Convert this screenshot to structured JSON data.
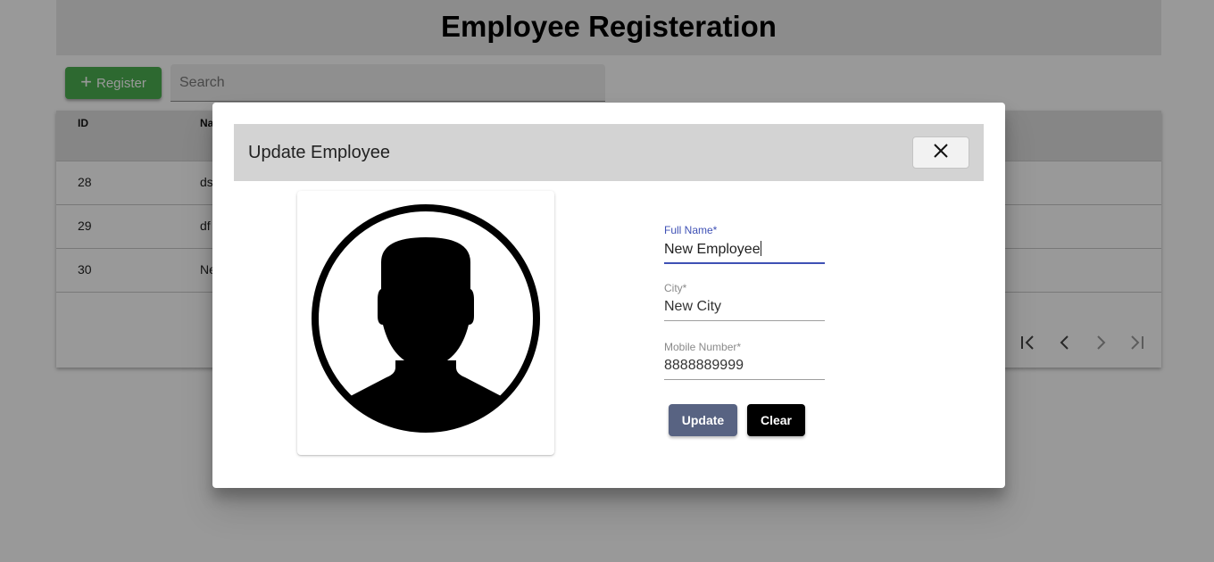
{
  "page": {
    "title": "Employee Registeration",
    "register_label": "Register",
    "search_placeholder": "Search"
  },
  "table": {
    "columns": [
      "ID",
      "Na"
    ],
    "rows": [
      {
        "id": "28",
        "name": "ds"
      },
      {
        "id": "29",
        "name": "df"
      },
      {
        "id": "30",
        "name": "Ne"
      }
    ],
    "pager": {
      "first": "|<",
      "prev": "<",
      "next": ">",
      "last": ">|"
    }
  },
  "dialog": {
    "title": "Update Employee",
    "close_symbol": "✕",
    "fields": {
      "full_name": {
        "label": "Full Name*",
        "value": "New Employee"
      },
      "city": {
        "label": "City*",
        "value": "New City"
      },
      "mobile": {
        "label": "Mobile Number*",
        "value": "8888889999"
      }
    },
    "update_label": "Update",
    "clear_label": "Clear"
  },
  "colors": {
    "register": "#4caf50",
    "focus": "#3f51b5",
    "update_button": "#4a5678",
    "clear_button": "#000000"
  },
  "icons": {
    "register": "plus-icon",
    "avatar": "user-silhouette-icon",
    "close": "close-icon",
    "pager": [
      "first-page-icon",
      "previous-page-icon",
      "next-page-icon",
      "last-page-icon"
    ]
  }
}
